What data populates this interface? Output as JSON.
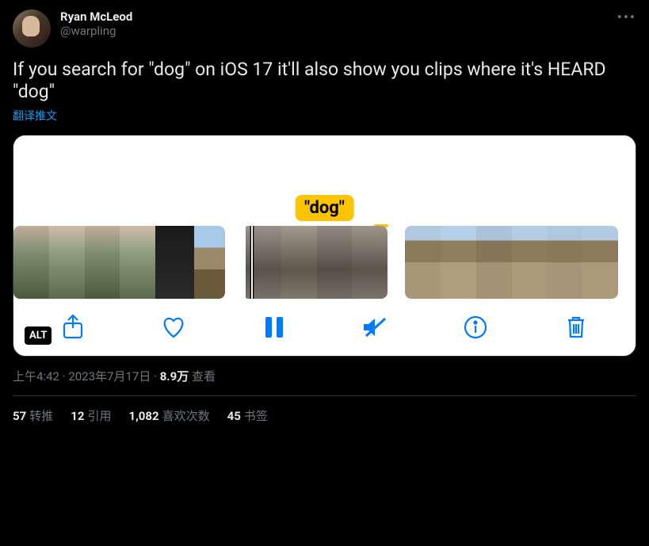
{
  "author": {
    "display_name": "Ryan McLeod",
    "handle": "@warpling"
  },
  "tweet_text": "If you search for \"dog\" on iOS 17 it'll also show you clips where it's HEARD \"dog\"",
  "translate_label": "翻译推文",
  "media": {
    "search_chip": "\"dog\"",
    "alt_badge": "ALT"
  },
  "timestamp": {
    "time": "上午4:42",
    "date": "2023年7月17日",
    "views_count": "8.9万",
    "views_label": "查看"
  },
  "stats": {
    "retweets_count": "57",
    "retweets_label": "转推",
    "quotes_count": "12",
    "quotes_label": "引用",
    "likes_count": "1,082",
    "likes_label": "喜欢次数",
    "bookmarks_count": "45",
    "bookmarks_label": "书签"
  }
}
